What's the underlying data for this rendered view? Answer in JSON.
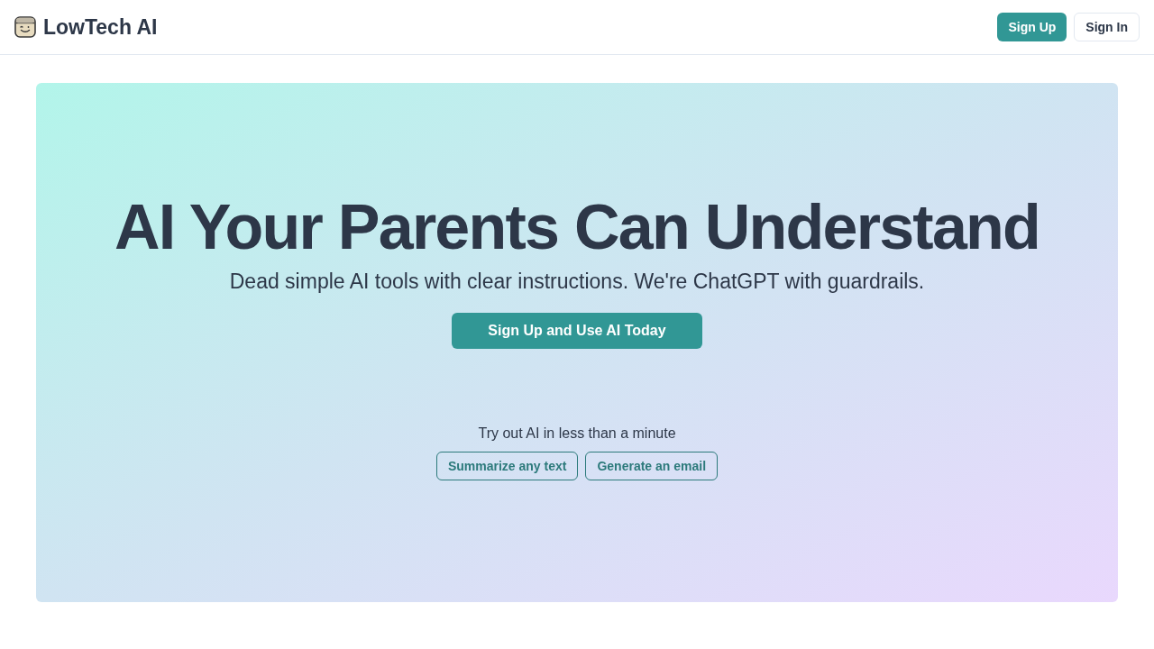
{
  "header": {
    "brand": "LowTech AI",
    "buttons": [
      {
        "label": "Sign Up",
        "kind": "primary"
      },
      {
        "label": "Sign In",
        "kind": "secondary"
      }
    ]
  },
  "hero": {
    "title": "AI Your Parents Can Understand",
    "subtitle": "Dead simple AI tools with clear instructions. We're ChatGPT with guardrails.",
    "cta": "Sign Up and Use AI Today",
    "tryout": {
      "label": "Try out AI in less than a minute",
      "buttons": [
        "Summarize any text",
        "Generate an email"
      ]
    }
  }
}
